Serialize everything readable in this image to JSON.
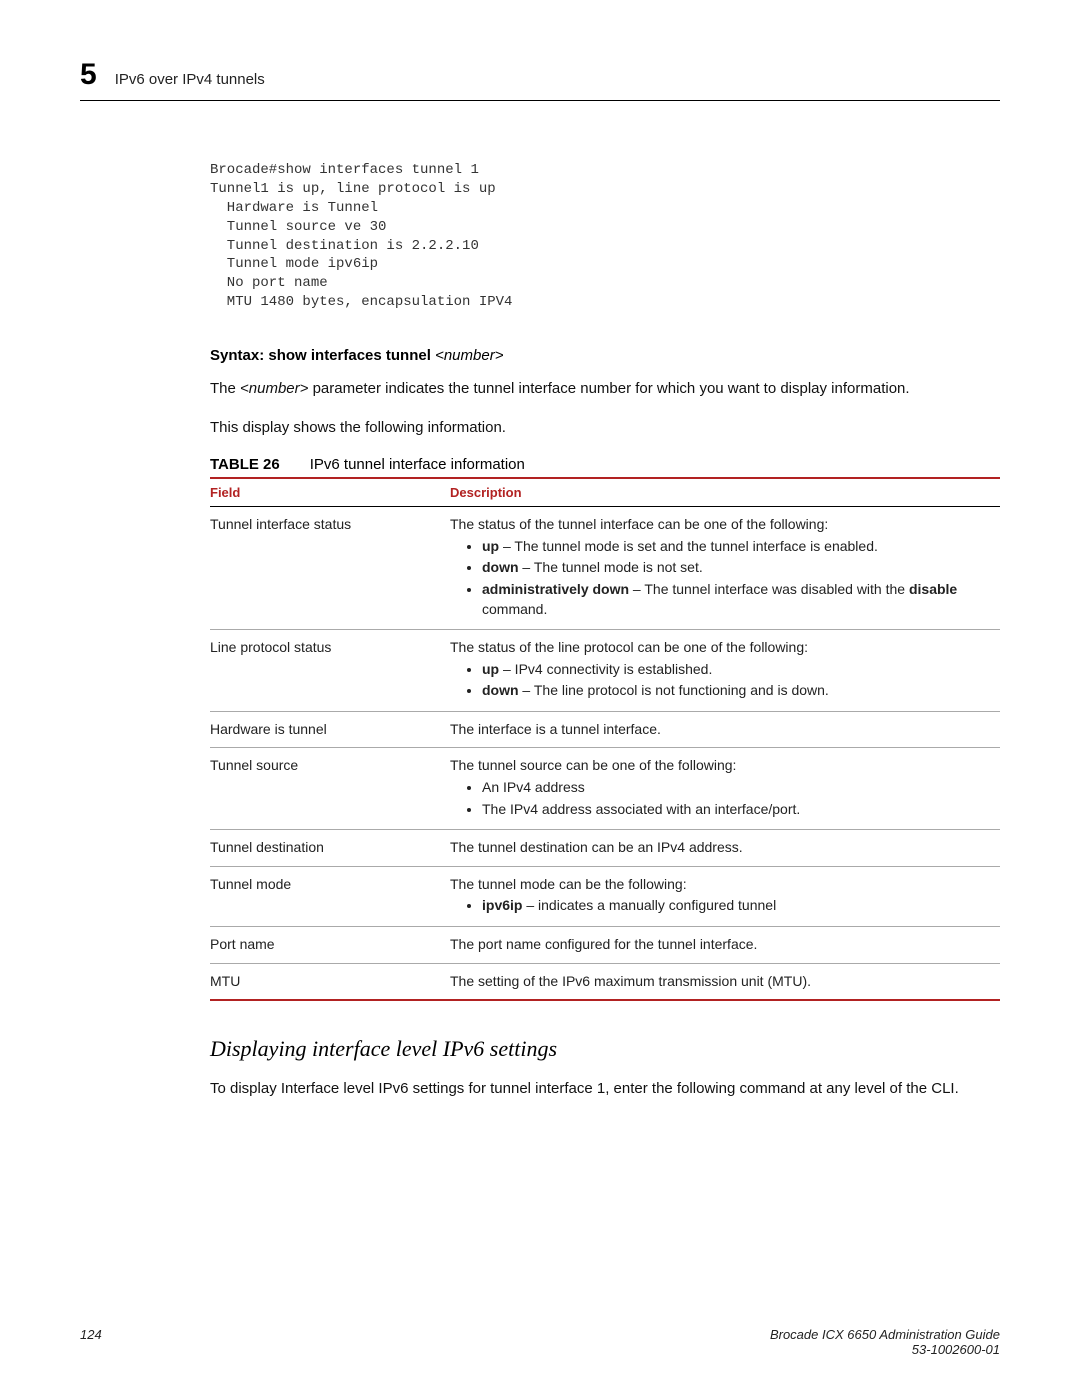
{
  "header": {
    "chapter_number": "5",
    "section_title": "IPv6 over IPv4 tunnels"
  },
  "code_block": "Brocade#show interfaces tunnel 1\nTunnel1 is up, line protocol is up\n  Hardware is Tunnel\n  Tunnel source ve 30\n  Tunnel destination is 2.2.2.10\n  Tunnel mode ipv6ip\n  No port name\n  MTU 1480 bytes, encapsulation IPV4",
  "syntax": {
    "label": "Syntax:",
    "command": "show interfaces tunnel",
    "arg": "<number>"
  },
  "para1_pre": "The ",
  "para1_italic": "<number>",
  "para1_post": " parameter indicates the tunnel interface number for which you want to display information.",
  "para2": "This display shows the following information.",
  "table": {
    "label": "TABLE 26",
    "caption": "IPv6 tunnel interface information",
    "head_field": "Field",
    "head_desc": "Description",
    "rows": {
      "r0": {
        "field": "Tunnel interface status",
        "intro": "The status of the tunnel interface can be one of the following:",
        "b0a": "up",
        "b0b": " – The tunnel mode is set and the tunnel interface is enabled.",
        "b1a": "down",
        "b1b": " – The tunnel mode is not set.",
        "b2a": "administratively down",
        "b2b": " – The tunnel interface was disabled with the ",
        "b2c": "disable",
        "b2d": " command."
      },
      "r1": {
        "field": "Line protocol status",
        "intro": "The status of the line protocol can be one of the following:",
        "b0a": "up",
        "b0b": " – IPv4 connectivity is established.",
        "b1a": "down",
        "b1b": " – The line protocol is not functioning and is down."
      },
      "r2": {
        "field": "Hardware is tunnel",
        "desc": "The interface is a tunnel interface."
      },
      "r3": {
        "field": "Tunnel source",
        "intro": "The tunnel source can be one of the following:",
        "b0": "An IPv4 address",
        "b1": "The IPv4 address associated with an interface/port."
      },
      "r4": {
        "field": "Tunnel destination",
        "desc": "The tunnel destination can be an IPv4 address."
      },
      "r5": {
        "field": "Tunnel mode",
        "intro": "The tunnel mode can be the following:",
        "b0a": "ipv6ip",
        "b0b": " – indicates a manually configured tunnel"
      },
      "r6": {
        "field": "Port name",
        "desc": "The port name configured for the tunnel interface."
      },
      "r7": {
        "field": "MTU",
        "desc": "The setting of the IPv6 maximum transmission unit (MTU)."
      }
    }
  },
  "subheading": "Displaying interface level IPv6 settings",
  "para3": "To display Interface level IPv6 settings for tunnel interface 1, enter the following command at any level of the CLI.",
  "footer": {
    "page_number": "124",
    "doc_title": "Brocade ICX 6650 Administration Guide",
    "doc_id": "53-1002600-01"
  }
}
